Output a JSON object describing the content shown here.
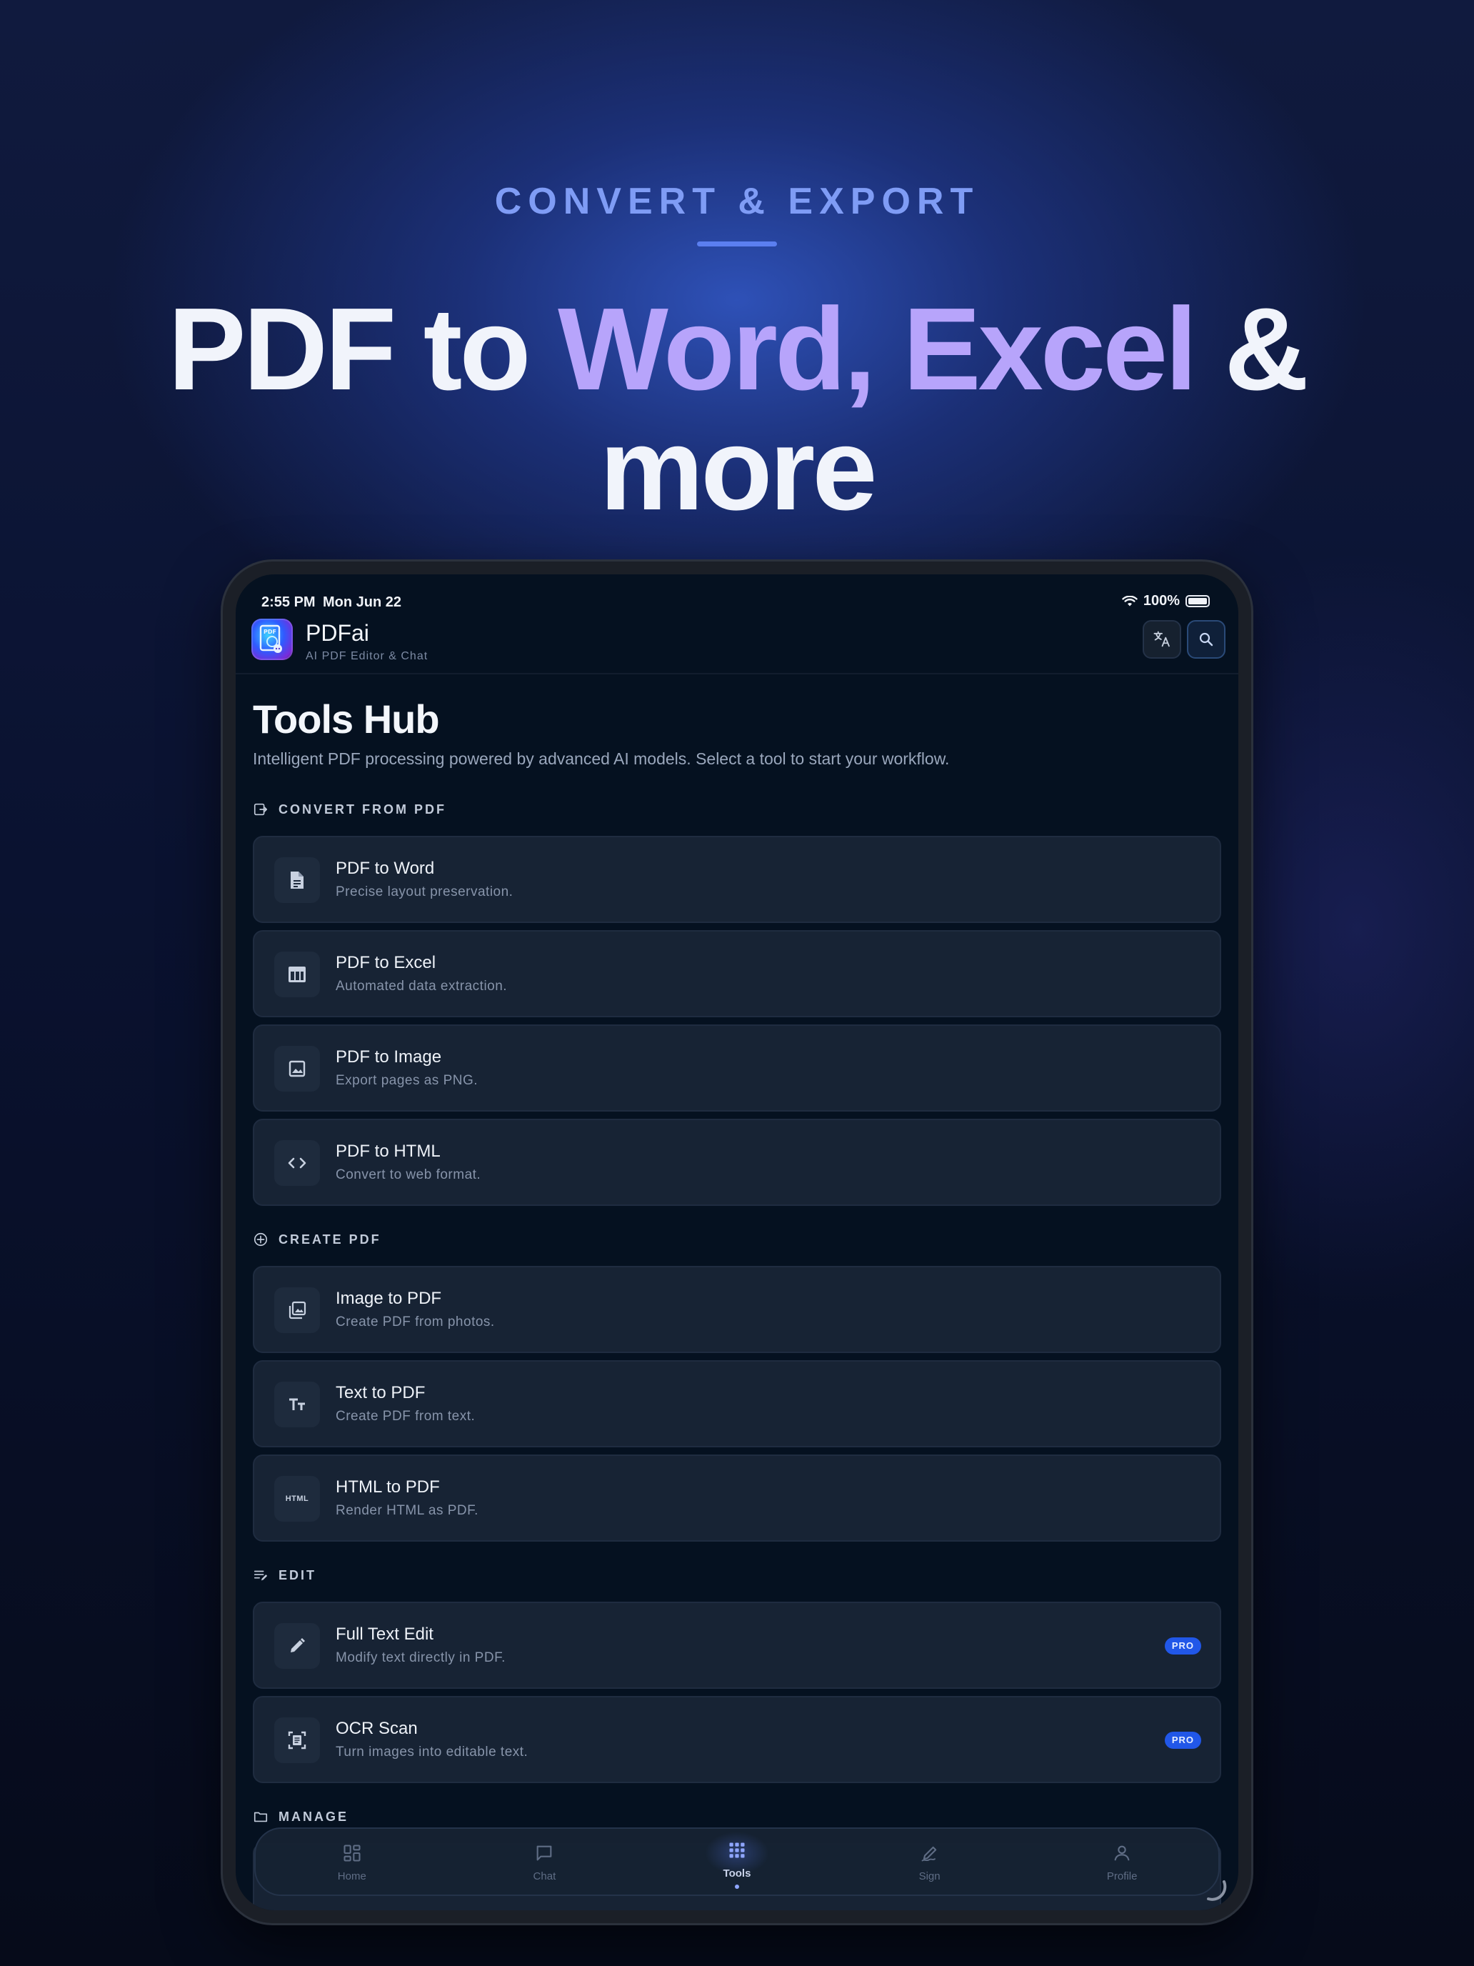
{
  "hero": {
    "eyebrow": "CONVERT & EXPORT",
    "headline_part1": "PDF to ",
    "headline_accent": "Word, Excel",
    "headline_part2": " &",
    "headline_line2": "more"
  },
  "colors": {
    "accent_purple": "#b7a4fb",
    "eyebrow_blue": "#7f9cf5",
    "pro_badge": "#2157e8",
    "card_bg": "#172334",
    "screen_bg": "#051120"
  },
  "status_bar": {
    "time": "2:55 PM",
    "date": "Mon Jun 22",
    "battery": "100%"
  },
  "app_bar": {
    "name": "PDFai",
    "subtitle": "AI PDF Editor & Chat",
    "logo_text": "PDF",
    "translate_icon": "translate-icon",
    "search_icon": "search-icon"
  },
  "page": {
    "title": "Tools Hub",
    "description": "Intelligent PDF processing powered by advanced AI models. Select a tool to start your workflow."
  },
  "sections": {
    "convert": {
      "label": "CONVERT FROM PDF",
      "icon": "export-icon",
      "items": [
        {
          "title": "PDF to Word",
          "sub": "Precise layout preservation.",
          "icon": "document-icon"
        },
        {
          "title": "PDF to Excel",
          "sub": "Automated data extraction.",
          "icon": "table-icon"
        },
        {
          "title": "PDF to Image",
          "sub": "Export pages as PNG.",
          "icon": "image-icon"
        },
        {
          "title": "PDF to HTML",
          "sub": "Convert to web format.",
          "icon": "code-icon"
        }
      ]
    },
    "create": {
      "label": "CREATE PDF",
      "icon": "add-circle-icon",
      "items": [
        {
          "title": "Image to PDF",
          "sub": "Create PDF from photos.",
          "icon": "photo-library-icon"
        },
        {
          "title": "Text to PDF",
          "sub": "Create PDF from text.",
          "icon": "text-fields-icon"
        },
        {
          "title": "HTML to PDF",
          "sub": "Render HTML as PDF.",
          "icon": "html-icon",
          "glyph": "HTML"
        }
      ]
    },
    "edit": {
      "label": "EDIT",
      "icon": "edit-note-icon",
      "items": [
        {
          "title": "Full Text Edit",
          "sub": "Modify text directly in PDF.",
          "icon": "pencil-icon",
          "badge": "PRO"
        },
        {
          "title": "OCR Scan",
          "sub": "Turn images into editable text.",
          "icon": "document-scanner-icon",
          "badge": "PRO"
        }
      ]
    },
    "manage": {
      "label": "MANAGE",
      "icon": "folder-icon"
    }
  },
  "tabbar": {
    "active": "Tools",
    "tabs": [
      {
        "label": "Home",
        "icon": "dashboard-icon"
      },
      {
        "label": "Chat",
        "icon": "chat-icon"
      },
      {
        "label": "Tools",
        "icon": "grid-icon"
      },
      {
        "label": "Sign",
        "icon": "signature-icon"
      },
      {
        "label": "Profile",
        "icon": "person-icon"
      }
    ]
  }
}
